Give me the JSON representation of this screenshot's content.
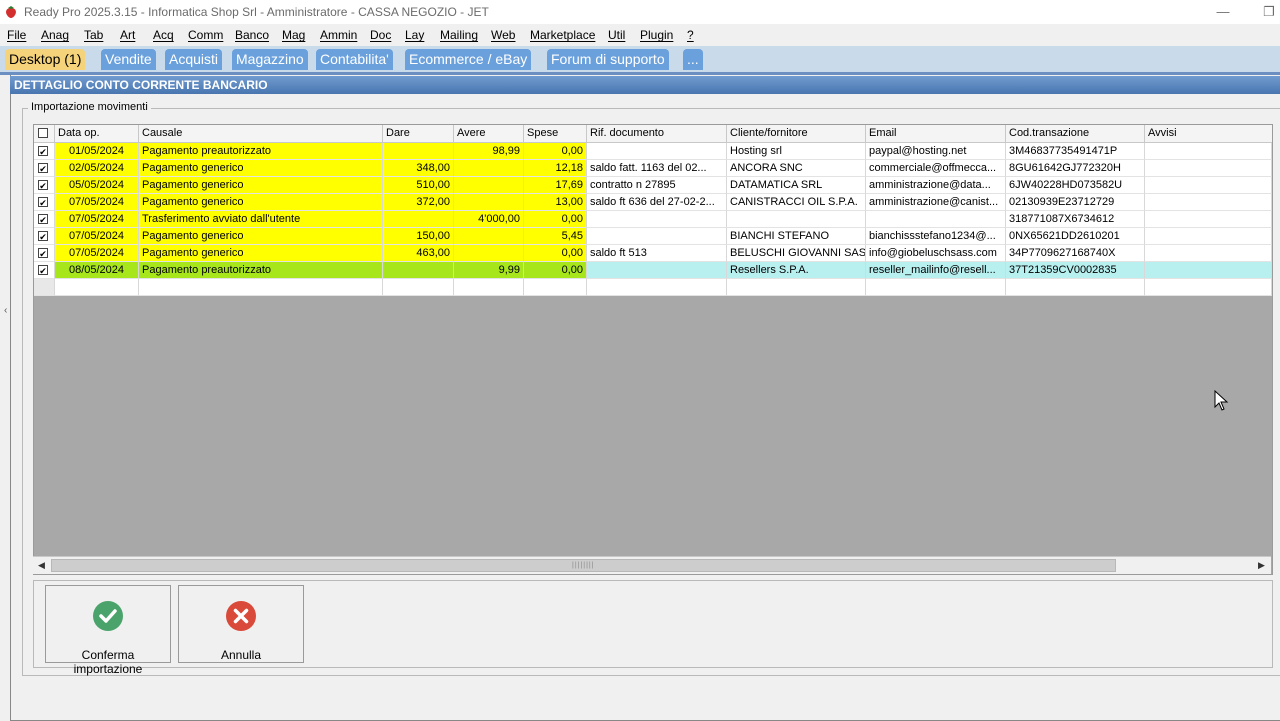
{
  "window": {
    "title": "Ready Pro 2025.3.15 - Informatica Shop Srl - Amministratore - CASSA NEGOZIO - JET",
    "minimize_glyph": "—",
    "restore_glyph": "❐"
  },
  "menu": [
    "File",
    "Anag",
    "Tab",
    "Art",
    "Acq",
    "Comm",
    "Banco",
    "Mag",
    "Ammin",
    "Doc",
    "Lay",
    "Mailing",
    "Web",
    "Marketplace",
    "Util",
    "Plugin",
    "?"
  ],
  "tabs": [
    "Desktop (1)",
    "Vendite",
    "Acquisti",
    "Magazzino",
    "Contabilita'",
    "Ecommerce / eBay",
    "Forum di supporto",
    "..."
  ],
  "panel": {
    "title": "DETTAGLIO CONTO CORRENTE BANCARIO",
    "group_title": "Importazione movimenti"
  },
  "table": {
    "columns": [
      "Data op.",
      "Causale",
      "Dare",
      "Avere",
      "Spese",
      "Rif. documento",
      "Cliente/fornitore",
      "Email",
      "Cod.transazione",
      "Avvisi"
    ],
    "rows": [
      {
        "checked": true,
        "date": "01/05/2024",
        "causale": "Pagamento preautorizzato",
        "dare": "",
        "avere": "98,99",
        "spese": "0,00",
        "rif": "",
        "cliente": "Hosting srl",
        "email": "paypal@hosting.net",
        "cod": "3M46837735491471P",
        "avvisi": "",
        "color": "#ffff00",
        "info_color": "#ffffff"
      },
      {
        "checked": true,
        "date": "02/05/2024",
        "causale": "Pagamento generico",
        "dare": "348,00",
        "avere": "",
        "spese": "12,18",
        "rif": "saldo fatt.   1163 del 02...",
        "cliente": "ANCORA SNC",
        "email": "commerciale@offmecca...",
        "cod": "8GU61642GJ772320H",
        "avvisi": "",
        "color": "#ffff00",
        "info_color": "#ffffff"
      },
      {
        "checked": true,
        "date": "05/05/2024",
        "causale": "Pagamento generico",
        "dare": "510,00",
        "avere": "",
        "spese": "17,69",
        "rif": "contratto n 27895",
        "cliente": "DATAMATICA SRL",
        "email": "amministrazione@data...",
        "cod": "6JW40228HD073582U",
        "avvisi": "",
        "color": "#ffff00",
        "info_color": "#ffffff"
      },
      {
        "checked": true,
        "date": "07/05/2024",
        "causale": "Pagamento generico",
        "dare": "372,00",
        "avere": "",
        "spese": "13,00",
        "rif": "saldo ft 636 del 27-02-2...",
        "cliente": "CANISTRACCI OIL S.P.A.",
        "email": "amministrazione@canist...",
        "cod": "02130939E23712729",
        "avvisi": "",
        "color": "#ffff00",
        "info_color": "#ffffff"
      },
      {
        "checked": true,
        "date": "07/05/2024",
        "causale": "Trasferimento avviato dall'utente",
        "dare": "",
        "avere": "4'000,00",
        "spese": "0,00",
        "rif": "",
        "cliente": "",
        "email": "",
        "cod": "318771087X6734612",
        "avvisi": "",
        "color": "#ffff00",
        "info_color": "#ffffff"
      },
      {
        "checked": true,
        "date": "07/05/2024",
        "causale": "Pagamento generico",
        "dare": "150,00",
        "avere": "",
        "spese": "5,45",
        "rif": "",
        "cliente": "BIANCHI STEFANO",
        "email": "bianchissstefano1234@...",
        "cod": "0NX65621DD2610201",
        "avvisi": "",
        "color": "#ffff00",
        "info_color": "#ffffff"
      },
      {
        "checked": true,
        "date": "07/05/2024",
        "causale": "Pagamento generico",
        "dare": "463,00",
        "avere": "",
        "spese": "0,00",
        "rif": "saldo ft 513",
        "cliente": "BELUSCHI GIOVANNI SAS",
        "email": "info@giobeluschsass.com",
        "cod": "34P7709627168740X",
        "avvisi": "",
        "color": "#ffff00",
        "info_color": "#ffffff"
      },
      {
        "checked": true,
        "date": "08/05/2024",
        "causale": "Pagamento preautorizzato",
        "dare": "",
        "avere": "9,99",
        "spese": "0,00",
        "rif": "",
        "cliente": "Resellers S.P.A.",
        "email": "reseller_mailinfo@resell...",
        "cod": "37T21359CV0002835",
        "avvisi": "",
        "color": "#a8e61c",
        "info_color": "#b8f0f0"
      }
    ]
  },
  "actions": {
    "confirm_label": "Conferma importazione",
    "cancel_label": "Annulla"
  },
  "colors": {
    "row_yellow": "#ffff00",
    "row_green": "#a8e61c",
    "row_cyan": "#b8f0f0",
    "confirm_icon": "#4aa36a",
    "cancel_icon": "#d94a3a",
    "tab_active": "#f4d37a",
    "tab_inactive": "#6aa0dc"
  }
}
